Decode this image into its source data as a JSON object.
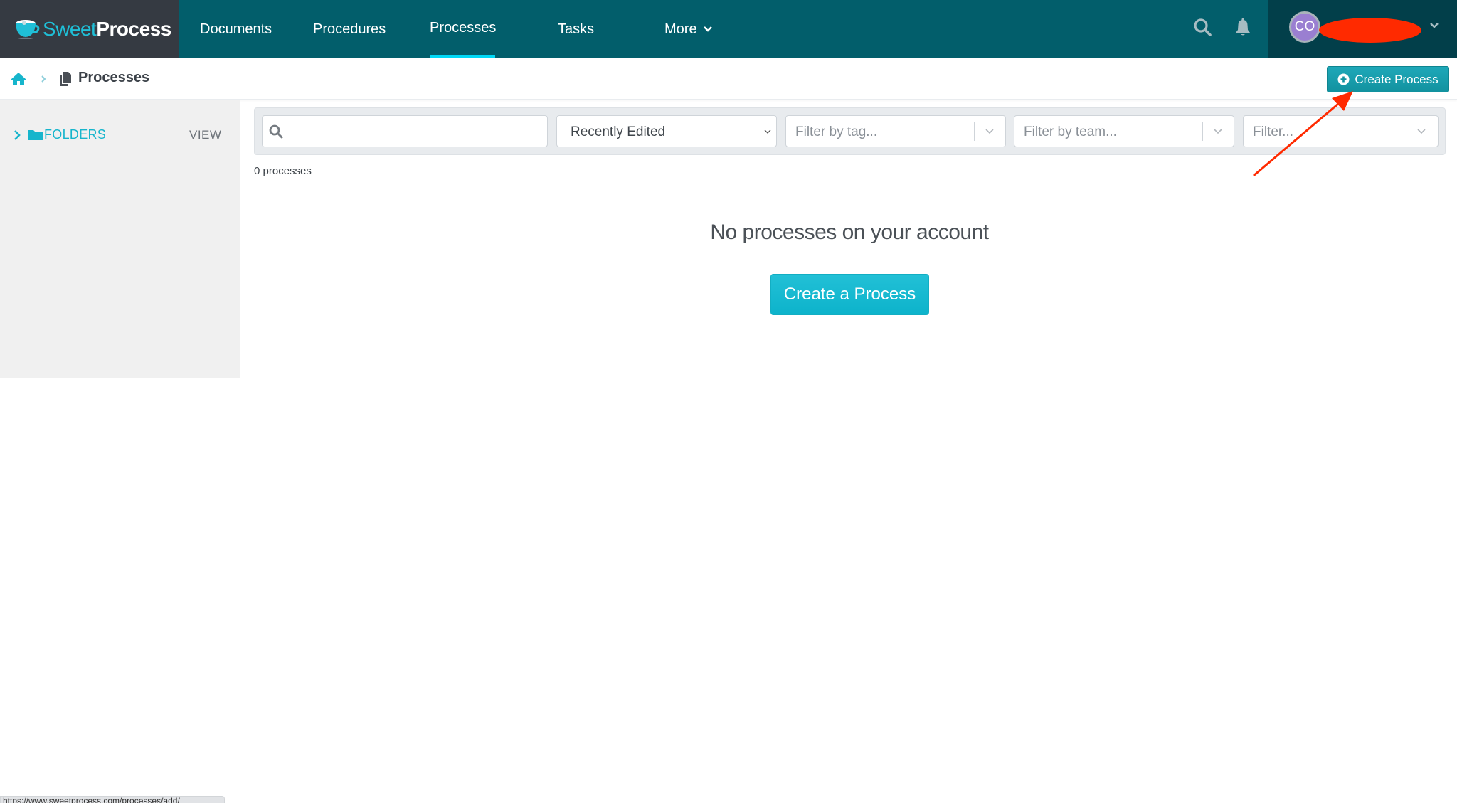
{
  "app": {
    "brand_sweet": "Sweet",
    "brand_process": "Process"
  },
  "nav": {
    "items": [
      {
        "label": "Documents",
        "active": false
      },
      {
        "label": "Procedures",
        "active": false
      },
      {
        "label": "Processes",
        "active": true
      },
      {
        "label": "Tasks",
        "active": false
      },
      {
        "label": "More",
        "active": false,
        "has_dropdown": true
      }
    ],
    "icons": [
      "search-icon",
      "bell-icon"
    ],
    "user": {
      "initials": "CO",
      "avatar_color": "#9a7fd1",
      "name_redacted": true
    }
  },
  "breadcrumb": {
    "home_icon": "home-icon",
    "separator_icon": "chevron-right-icon",
    "page_icon": "documents-icon",
    "title": "Processes"
  },
  "toolbar": {
    "create_button_label": "Create Process",
    "create_button_icon": "plus-circle-icon"
  },
  "sidebar": {
    "folders_label": "FOLDERS",
    "view_label": "VIEW"
  },
  "filters": {
    "search": {
      "value": "",
      "placeholder": ""
    },
    "sort": {
      "selected": "Recently Edited"
    },
    "tag": {
      "placeholder": "Filter by tag..."
    },
    "team": {
      "placeholder": "Filter by team..."
    },
    "other": {
      "placeholder": "Filter..."
    }
  },
  "results": {
    "count_label": "0 processes"
  },
  "empty_state": {
    "title": "No processes on your account",
    "button_label": "Create a Process"
  },
  "status_bar": {
    "text": "https://www.sweetprocess.com/processes/add/"
  },
  "colors": {
    "nav_bg": "#025e6b",
    "logo_bg": "#353a42",
    "user_panel_bg": "#023f4a",
    "accent": "#16b5cc",
    "active_underline": "#00d8f5",
    "primary_button": "#12929f",
    "annotation_arrow": "#ff2a00"
  }
}
